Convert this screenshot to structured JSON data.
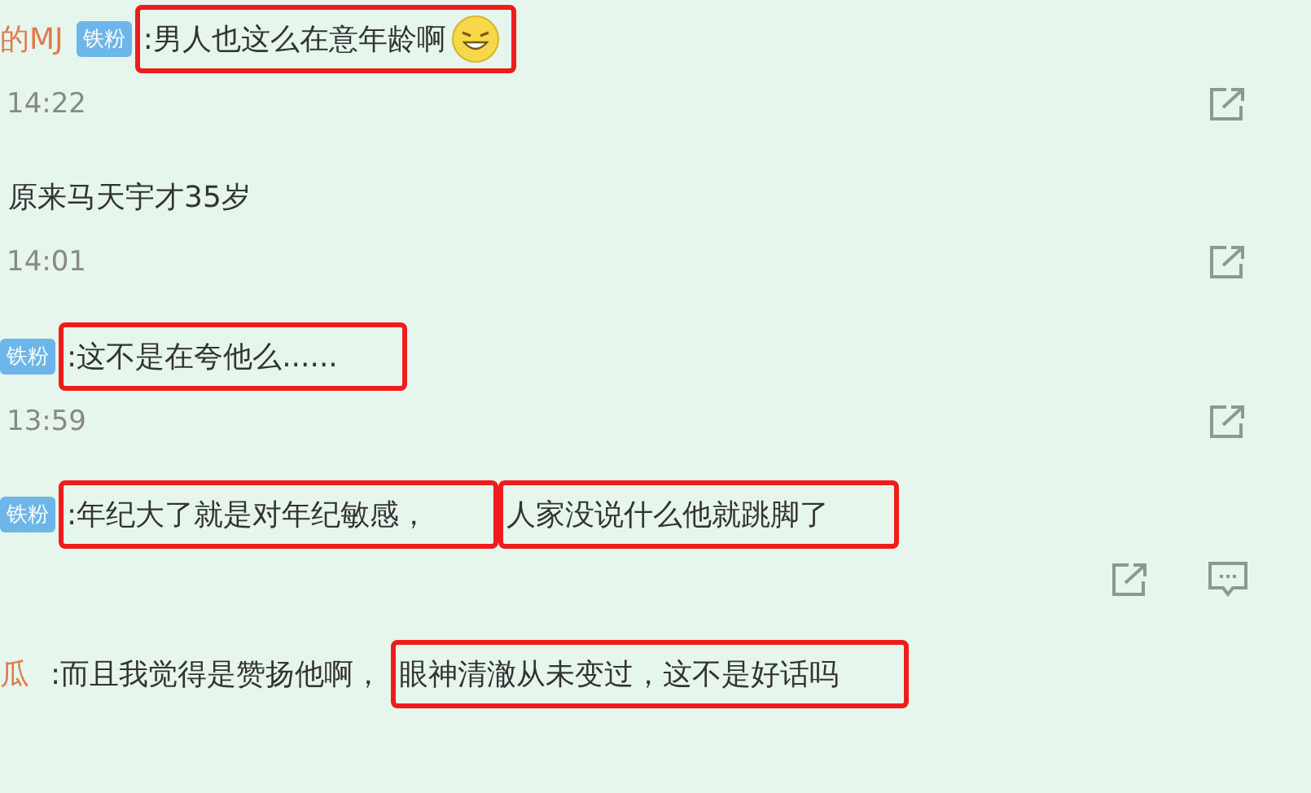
{
  "comments": [
    {
      "user": "的MJ",
      "badge": "铁粉",
      "segments": [
        {
          "kind": "text",
          "text": ":男人也这么在意年龄啊",
          "highlighted": true
        },
        {
          "kind": "emoji"
        }
      ],
      "time": "14:22",
      "actions": [
        {
          "kind": "share"
        }
      ]
    },
    {
      "segments": [
        {
          "kind": "text",
          "text": "原来马天宇才35岁",
          "highlighted": false
        }
      ],
      "time": "14:01",
      "actions": [
        {
          "kind": "share"
        }
      ]
    },
    {
      "badge": "铁粉",
      "segments": [
        {
          "kind": "text",
          "text": ":这不是在夸他么......",
          "highlighted": true
        }
      ],
      "time": "13:59",
      "actions": [
        {
          "kind": "share"
        }
      ]
    },
    {
      "badge": "铁粉",
      "segments": [
        {
          "kind": "text",
          "text": ":年纪大了就是对年纪敏感，",
          "highlighted": true
        },
        {
          "kind": "text",
          "text": "人家没说什么他就跳脚了",
          "highlighted": true
        }
      ],
      "actions": [
        {
          "kind": "share"
        },
        {
          "kind": "comment"
        }
      ]
    },
    {
      "user": "瓜",
      "segments": [
        {
          "kind": "text",
          "text": ":而且我觉得是赞扬他啊，",
          "highlighted": false
        },
        {
          "kind": "text",
          "text": "眼神清澈从未变过，这不是好话吗",
          "highlighted": true
        }
      ]
    }
  ]
}
